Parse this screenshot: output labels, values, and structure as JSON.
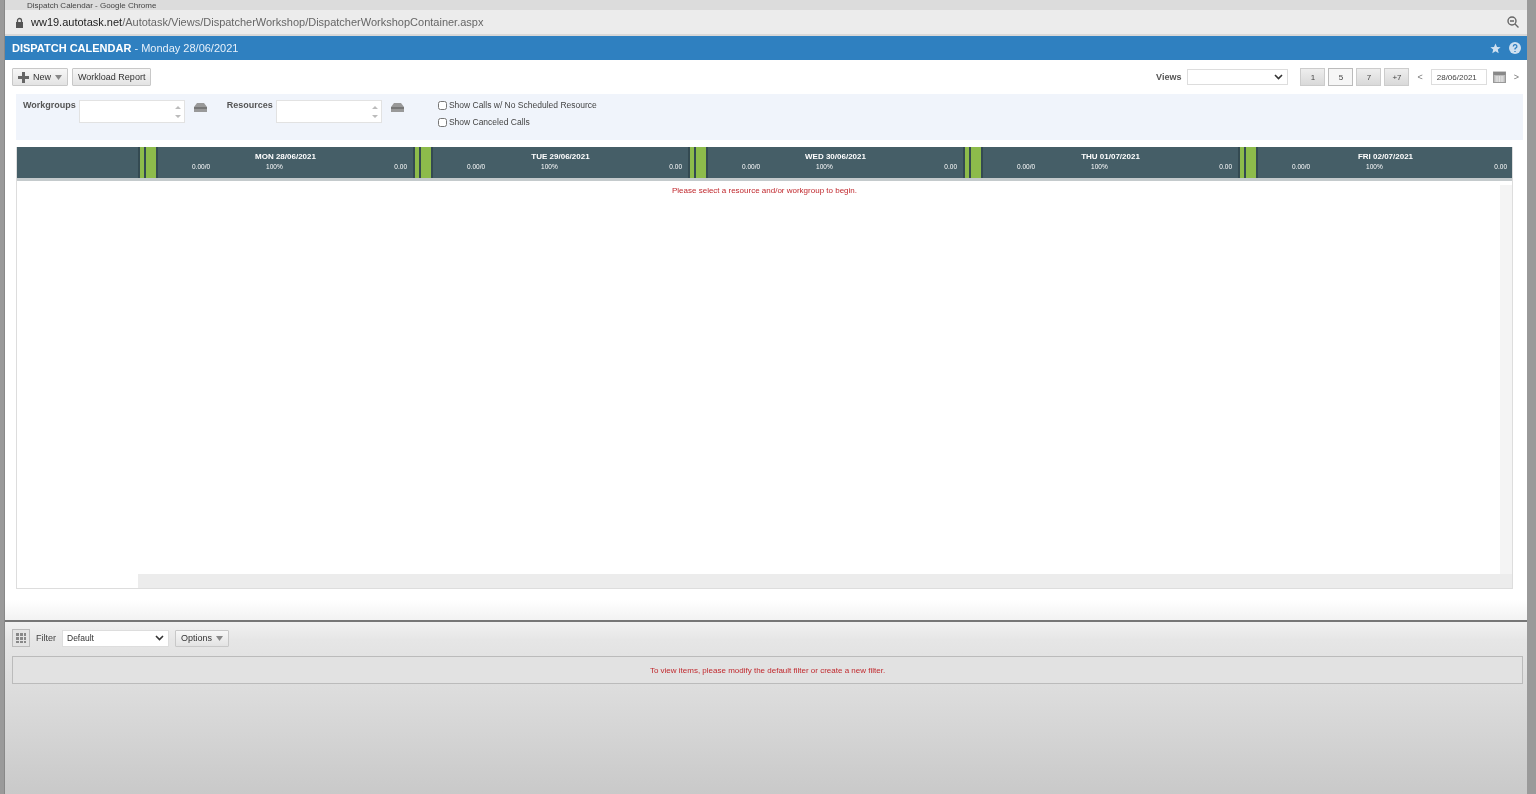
{
  "window": {
    "title": "Dispatch Calendar - Google Chrome"
  },
  "address_bar": {
    "host": "ww19.autotask.net",
    "path": "/Autotask/Views/DispatcherWorkshop/DispatcherWorkshopContainer.aspx"
  },
  "header": {
    "title": "DISPATCH CALENDAR",
    "subtitle": "- Monday 28/06/2021"
  },
  "toolbar": {
    "buttons": [
      {
        "label": "New",
        "kind": "menu"
      },
      {
        "label": "Workload Report",
        "kind": "plain"
      }
    ],
    "views_label": "Views",
    "range_buttons": [
      {
        "label": "1",
        "selected": false
      },
      {
        "label": "5",
        "selected": true
      },
      {
        "label": "7",
        "selected": false
      },
      {
        "label": "+7",
        "selected": false
      }
    ],
    "prev": "<",
    "date": "28/06/2021",
    "next": ">"
  },
  "filters": {
    "workgroups_label": "Workgroups",
    "resources_label": "Resources",
    "checkboxes": [
      {
        "label": "Show Calls w/ No Scheduled Resource",
        "checked": false
      },
      {
        "label": "Show Canceled Calls",
        "checked": false
      }
    ]
  },
  "days": [
    {
      "label": "MON 28/06/2021",
      "hours": "0.00/0",
      "percent": "100%",
      "total": "0.00"
    },
    {
      "label": "TUE 29/06/2021",
      "hours": "0.00/0",
      "percent": "100%",
      "total": "0.00"
    },
    {
      "label": "WED 30/06/2021",
      "hours": "0.00/0",
      "percent": "100%",
      "total": "0.00"
    },
    {
      "label": "THU 01/07/2021",
      "hours": "0.00/0",
      "percent": "100%",
      "total": "0.00"
    },
    {
      "label": "FRI 02/07/2021",
      "hours": "0.00/0",
      "percent": "100%",
      "total": "0.00"
    }
  ],
  "calendar_message": "Please select a resource and/or workgroup to begin.",
  "bottom": {
    "filter_label": "Filter",
    "filter_value": "Default",
    "options_label": "Options",
    "message": "To view items, please modify the default filter or create a new filter."
  }
}
